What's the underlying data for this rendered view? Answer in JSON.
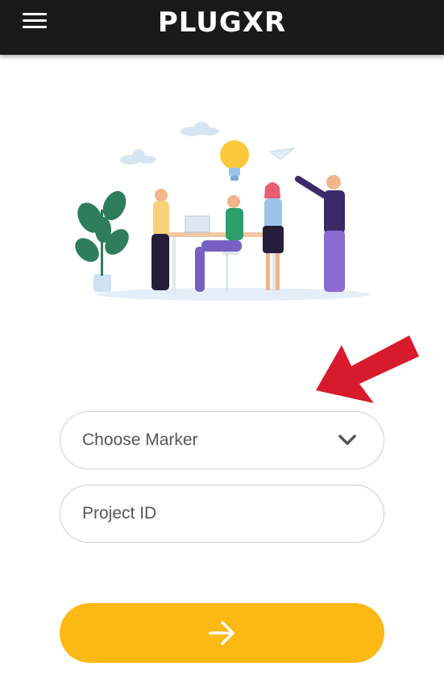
{
  "header": {
    "logo_text": "PLUGXR",
    "menu_icon": "hamburger-menu-icon",
    "background": "#1a1a1a"
  },
  "illustration": {
    "icon": "team-office-illustration"
  },
  "annotation": {
    "icon": "red-pointer-arrow-icon",
    "color": "#d81b2c"
  },
  "form": {
    "marker_select": {
      "selected_value": "Choose Marker",
      "icon": "chevron-down-icon"
    },
    "project_id": {
      "placeholder": "Project ID"
    },
    "submit": {
      "icon": "arrow-right-icon",
      "color": "#fcb813"
    }
  }
}
